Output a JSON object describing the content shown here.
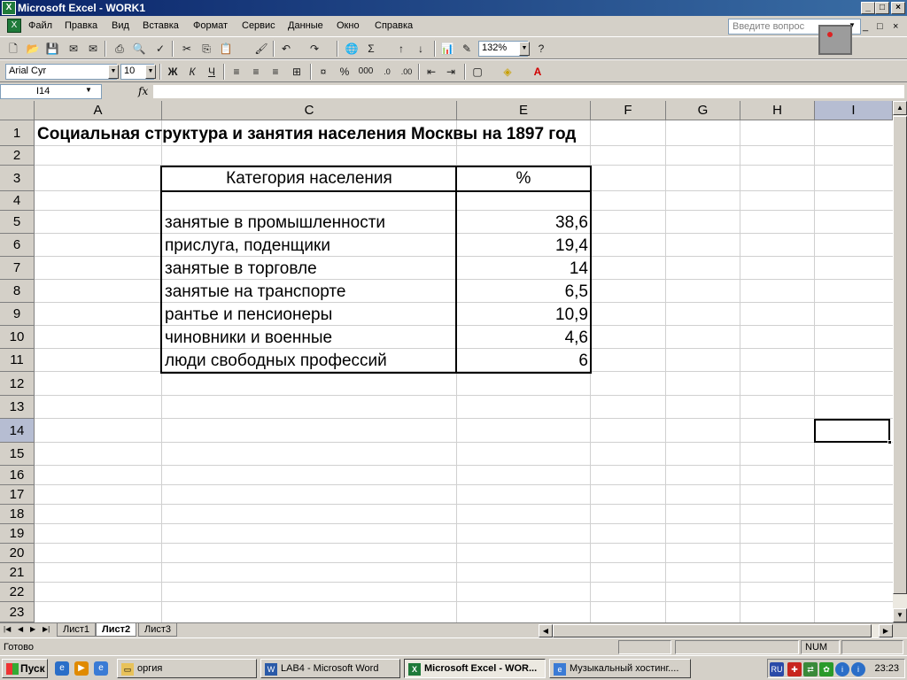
{
  "window": {
    "title": "Microsoft Excel - WORK1",
    "min_label": "_",
    "max_label": "□",
    "close_label": "×",
    "doc_min_label": "_",
    "doc_restore_label": "□",
    "doc_close_label": "×"
  },
  "menu": {
    "items": [
      "Файл",
      "Правка",
      "Вид",
      "Вставка",
      "Формат",
      "Сервис",
      "Данные",
      "Окно",
      "Справка"
    ],
    "help_placeholder": "Введите вопрос"
  },
  "toolbar": {
    "zoom": "132%",
    "font_name": "Arial Cyr",
    "font_size": "10",
    "bold_label": "Ж",
    "italic_label": "К",
    "underline_label": "Ч",
    "percent_label": "%",
    "thousands_label": "000"
  },
  "formula_bar": {
    "name_box": "I14",
    "fx": "fx",
    "formula": ""
  },
  "columns": [
    {
      "label": "A"
    },
    {
      "label": "C"
    },
    {
      "label": "E"
    },
    {
      "label": "F"
    },
    {
      "label": "G"
    },
    {
      "label": "H"
    },
    {
      "label": "I"
    }
  ],
  "rows": [
    "1",
    "2",
    "3",
    "4",
    "5",
    "6",
    "7",
    "8",
    "9",
    "10",
    "11",
    "12",
    "13",
    "14",
    "15",
    "16",
    "17",
    "18",
    "19",
    "20",
    "21",
    "22",
    "23"
  ],
  "sheet": {
    "title": "Социальная структура и занятия населения Москвы на 1897 год",
    "header_category": "Категория населения",
    "header_percent": "%",
    "table_rows": [
      {
        "category": "занятые в промышленности",
        "percent": "38,6"
      },
      {
        "category": "прислуга, поденщики",
        "percent": "19,4"
      },
      {
        "category": "занятые в торговле",
        "percent": "14"
      },
      {
        "category": "занятые на транспорте",
        "percent": "6,5"
      },
      {
        "category": "рантье и пенсионеры",
        "percent": "10,9"
      },
      {
        "category": "чиновники и военные",
        "percent": "4,6"
      },
      {
        "category": "люди свободных профессий",
        "percent": "6"
      }
    ]
  },
  "tabs": [
    "Лист1",
    "Лист2",
    "Лист3"
  ],
  "active_tab": "Лист2",
  "status": {
    "text": "Готово",
    "num": "NUM"
  },
  "taskbar": {
    "start": "Пуск",
    "tasks": [
      "оргия",
      "LAB4 - Microsoft Word",
      "Microsoft Excel - WOR...",
      "Музыкальный хостинг...."
    ],
    "lang": "RU",
    "clock": "23:23"
  }
}
